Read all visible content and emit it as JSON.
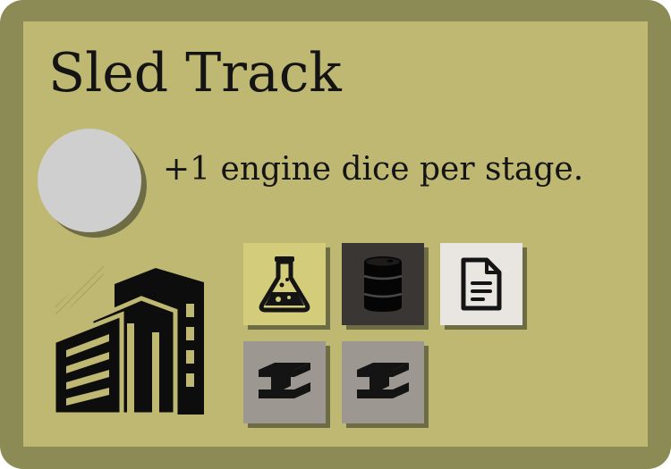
{
  "card": {
    "title": "Sled Track",
    "effect": "+1 engine dice per stage.",
    "colors": {
      "border": "#8c8a55",
      "background": "#bfb872",
      "cost_circle": "#cfcfcf",
      "text": "#141414"
    },
    "building_icon": "office-building-icon",
    "resources": [
      {
        "icon": "flask-icon",
        "color": "#d3cc7a"
      },
      {
        "icon": "oil-barrel-icon",
        "color": "#3a3634"
      },
      {
        "icon": "document-icon",
        "color": "#e9e6e2"
      },
      {
        "icon": "steel-beam-icon",
        "color": "#9c9891"
      },
      {
        "icon": "steel-beam-icon",
        "color": "#9c9891"
      }
    ]
  }
}
